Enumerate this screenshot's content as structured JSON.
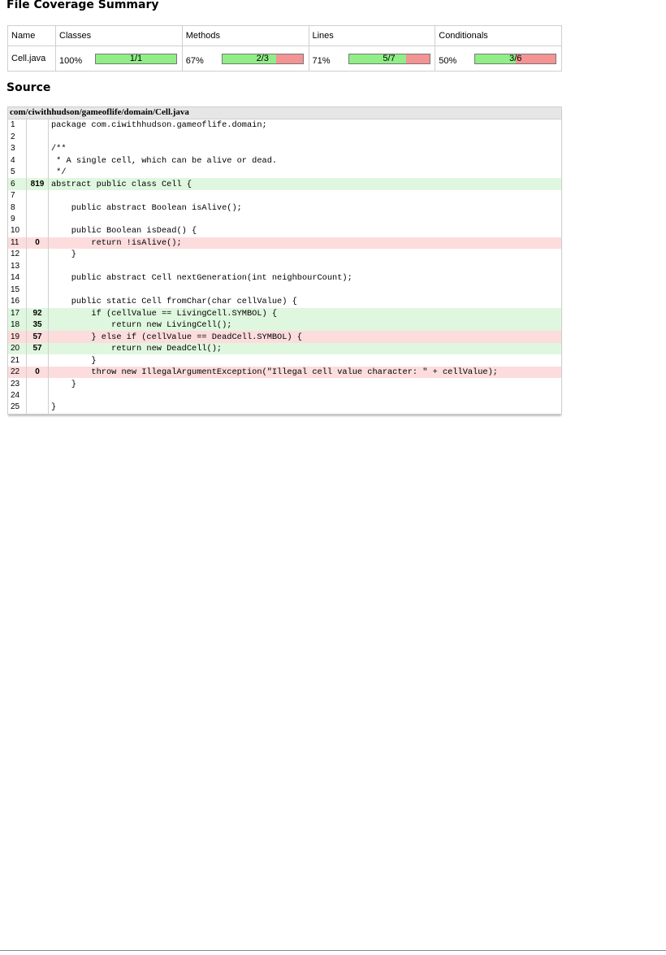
{
  "summary": {
    "title": "File Coverage Summary",
    "headers": [
      "Name",
      "Classes",
      "Methods",
      "Lines",
      "Conditionals"
    ],
    "file_name": "Cell.java",
    "metrics": [
      {
        "percent": "100%",
        "ratio": "1/1",
        "fraction": 1.0
      },
      {
        "percent": "67%",
        "ratio": "2/3",
        "fraction": 0.667
      },
      {
        "percent": "71%",
        "ratio": "5/7",
        "fraction": 0.714
      },
      {
        "percent": "50%",
        "ratio": "3/6",
        "fraction": 0.5
      }
    ],
    "colors": {
      "covered": "#90ee86",
      "uncovered": "#f39394"
    }
  },
  "source": {
    "title": "Source",
    "path": "com/ciwithhudson/gameoflife/domain/Cell.java",
    "colors": {
      "hit_row": "#dff7df",
      "miss_row": "#fcdcdc"
    },
    "lines": [
      {
        "n": "1",
        "hits": "",
        "status": "none",
        "code": "package com.ciwithhudson.gameoflife.domain;"
      },
      {
        "n": "2",
        "hits": "",
        "status": "none",
        "code": ""
      },
      {
        "n": "3",
        "hits": "",
        "status": "none",
        "code": "/**"
      },
      {
        "n": "4",
        "hits": "",
        "status": "none",
        "code": " * A single cell, which can be alive or dead."
      },
      {
        "n": "5",
        "hits": "",
        "status": "none",
        "code": " */"
      },
      {
        "n": "6",
        "hits": "819",
        "status": "hit",
        "code": "abstract public class Cell {"
      },
      {
        "n": "7",
        "hits": "",
        "status": "none",
        "code": ""
      },
      {
        "n": "8",
        "hits": "",
        "status": "none",
        "code": "    public abstract Boolean isAlive();"
      },
      {
        "n": "9",
        "hits": "",
        "status": "none",
        "code": ""
      },
      {
        "n": "10",
        "hits": "",
        "status": "none",
        "code": "    public Boolean isDead() {"
      },
      {
        "n": "11",
        "hits": "0",
        "status": "miss",
        "code": "        return !isAlive();"
      },
      {
        "n": "12",
        "hits": "",
        "status": "none",
        "code": "    }"
      },
      {
        "n": "13",
        "hits": "",
        "status": "none",
        "code": ""
      },
      {
        "n": "14",
        "hits": "",
        "status": "none",
        "code": "    public abstract Cell nextGeneration(int neighbourCount);"
      },
      {
        "n": "15",
        "hits": "",
        "status": "none",
        "code": ""
      },
      {
        "n": "16",
        "hits": "",
        "status": "none",
        "code": "    public static Cell fromChar(char cellValue) {"
      },
      {
        "n": "17",
        "hits": "92",
        "status": "hit",
        "code": "        if (cellValue == LivingCell.SYMBOL) {"
      },
      {
        "n": "18",
        "hits": "35",
        "status": "hit",
        "code": "            return new LivingCell();"
      },
      {
        "n": "19",
        "hits": "57",
        "status": "miss",
        "code": "        } else if (cellValue == DeadCell.SYMBOL) {"
      },
      {
        "n": "20",
        "hits": "57",
        "status": "hit",
        "code": "            return new DeadCell();"
      },
      {
        "n": "21",
        "hits": "",
        "status": "none",
        "code": "        }"
      },
      {
        "n": "22",
        "hits": "0",
        "status": "miss",
        "code": "        throw new IllegalArgumentException(\"Illegal cell value character: \" + cellValue);"
      },
      {
        "n": "23",
        "hits": "",
        "status": "none",
        "code": "    }"
      },
      {
        "n": "24",
        "hits": "",
        "status": "none",
        "code": ""
      },
      {
        "n": "25",
        "hits": "",
        "status": "none",
        "code": "}"
      }
    ]
  }
}
